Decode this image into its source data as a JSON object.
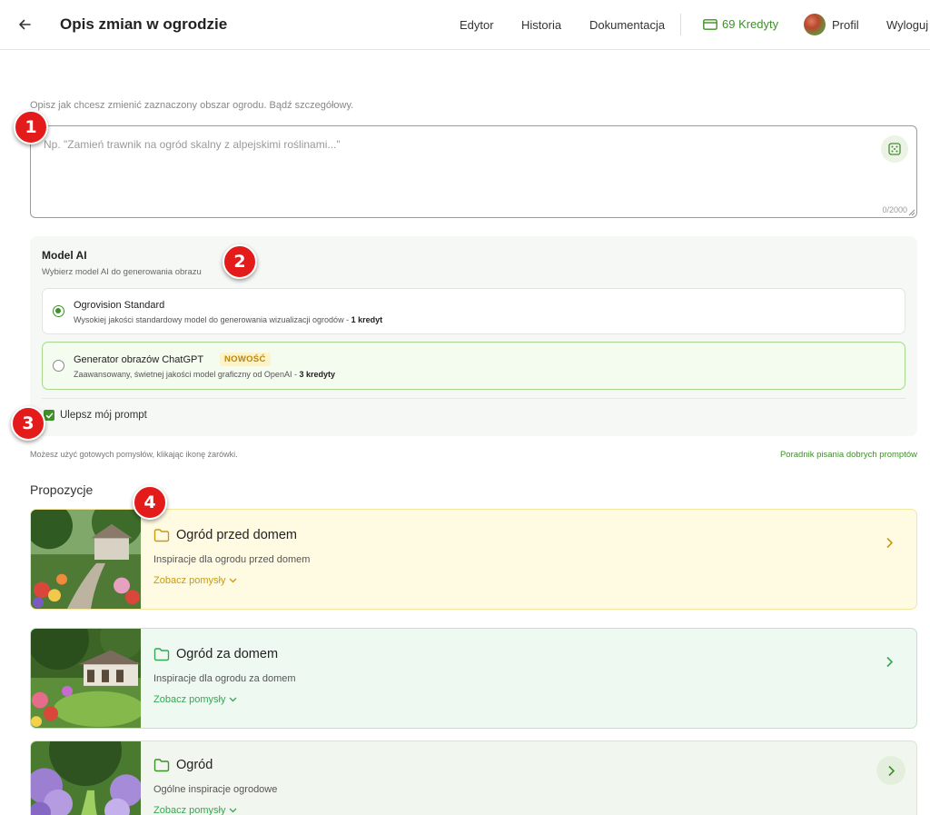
{
  "header": {
    "title": "Opis zmian w ogrodzie",
    "nav": [
      "Edytor",
      "Historia",
      "Dokumentacja"
    ],
    "credits": "69 Kredyty",
    "profile": "Profil",
    "logout": "Wyloguj"
  },
  "description": {
    "instruction": "Opisz jak chcesz zmienić zaznaczony obszar ogrodu. Bądź szczegółowy.",
    "placeholder": "Np. \"Zamień trawnik na ogród skalny z alpejskimi roślinami...\"",
    "value": "",
    "char_count": "0/2000"
  },
  "model": {
    "title": "Model AI",
    "subtitle": "Wybierz model AI do generowania obrazu",
    "options": [
      {
        "name": "Ogrovision Standard",
        "desc": "Wysokiej jakości standardowy model do generowania wizualizacji ogrodów - ",
        "cost": "1 kredyt",
        "selected": true
      },
      {
        "name": "Generator obrazów ChatGPT",
        "badge": "NOWOŚĆ",
        "desc": "Zaawansowany, świetnej jakości model graficzny od OpenAI - ",
        "cost": "3 kredyty",
        "selected": false
      }
    ],
    "enhance_label": "Ulepsz mój prompt",
    "enhance_checked": true
  },
  "hint": "Możesz użyć gotowych pomysłów, klikając ikonę żarówki.",
  "guide_link": "Poradnik pisania dobrych promptów",
  "proposals": {
    "title": "Propozycje",
    "cards": [
      {
        "title": "Ogród przed domem",
        "desc": "Inspiracje dla ogrodu przed domem",
        "more": "Zobacz pomysły",
        "accent": "#c79a12"
      },
      {
        "title": "Ogród za domem",
        "desc": "Inspiracje dla ogrodu za domem",
        "more": "Zobacz pomysły",
        "accent": "#35a653"
      },
      {
        "title": "Ogród",
        "desc": "Ogólne inspiracje ogrodowe",
        "more": "Zobacz pomysły",
        "accent": "#3f8f2a"
      }
    ]
  },
  "markers": [
    "1",
    "2",
    "3",
    "4"
  ],
  "colors": {
    "primary": "#3f8f2a",
    "marker": "#e31b1b"
  }
}
